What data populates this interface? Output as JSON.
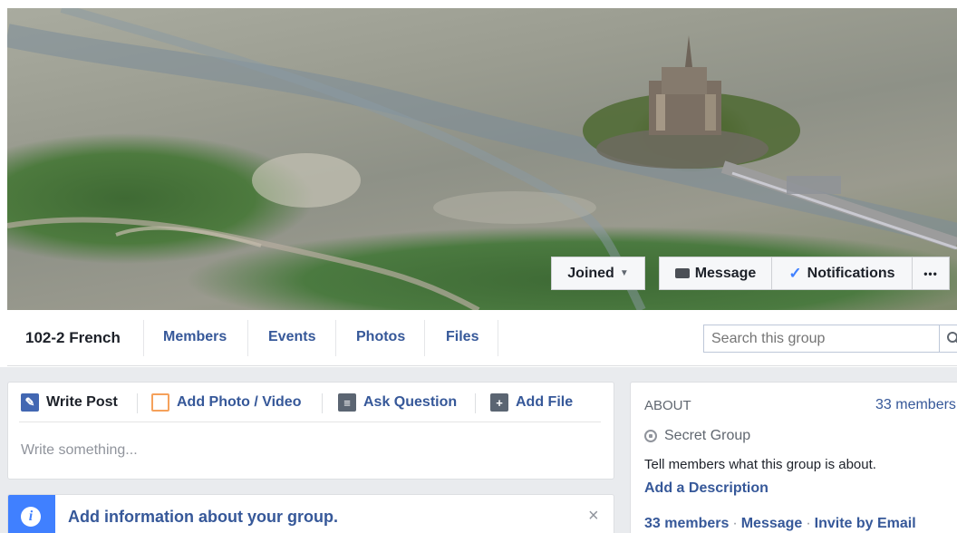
{
  "cover": {
    "joined_label": "Joined",
    "message_label": "Message",
    "notifications_label": "Notifications",
    "more_label": "•••"
  },
  "nav": {
    "group_name": "102-2 French",
    "tabs": [
      "Members",
      "Events",
      "Photos",
      "Files"
    ],
    "search_placeholder": "Search this group"
  },
  "composer": {
    "tabs": [
      "Write Post",
      "Add Photo / Video",
      "Ask Question",
      "Add File"
    ],
    "placeholder": "Write something..."
  },
  "info_banner": {
    "text": "Add information about your group.",
    "close": "×"
  },
  "about": {
    "heading": "ABOUT",
    "member_count": "33 members",
    "privacy": "Secret Group",
    "description": "Tell members what this group is about.",
    "add_description": "Add a Description",
    "links": [
      "33 members",
      "Message",
      "Invite by Email"
    ]
  },
  "colors": {
    "link": "#365899",
    "info_accent": "#4080ff",
    "page_bg": "#e9ebee"
  }
}
